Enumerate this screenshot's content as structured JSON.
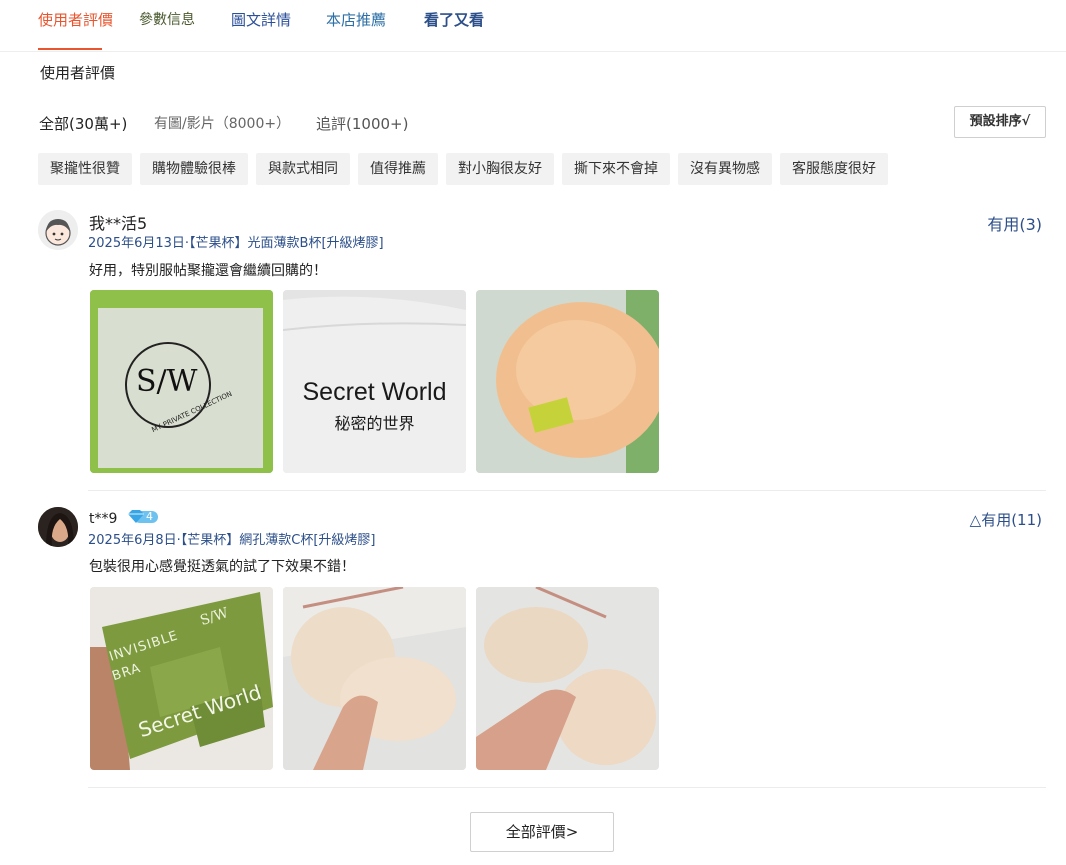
{
  "tabs": [
    {
      "label": "使用者評價",
      "color": "#e8552f"
    },
    {
      "label": "參數信息",
      "color": "#4b5a2e"
    },
    {
      "label": "圖文詳情",
      "color": "#2c4f9a"
    },
    {
      "label": "本店推薦",
      "color": "#2d6fa6"
    },
    {
      "label": "看了又看",
      "color": "#2c4f8a"
    }
  ],
  "section_title": "使用者評價",
  "filters": {
    "all": "全部(30萬+)",
    "media": "有圖/影片（8000+）",
    "followup": "追評(1000+)"
  },
  "sort_label": "預設排序√",
  "tags": [
    "聚攏性很贊",
    "購物體驗很棒",
    "與款式相同",
    "值得推薦",
    "對小胸很友好",
    "撕下來不會掉",
    "沒有異物感",
    "客服態度很好"
  ],
  "reviews": [
    {
      "username": "我**活5",
      "meta": "2025年6月13日·【芒果杯】光面薄款B杯[升級烤膠]",
      "comment": "好用，特別服帖聚攏還會繼續回購的！",
      "helpful": "有用(3)",
      "photos": [
        {
          "logo": "S/W",
          "caption": "MY PRIVATE COLLECTION"
        },
        {
          "brand": "Secret World",
          "subtitle": "秘密的世界"
        },
        {
          "label": "pad-photo"
        }
      ]
    },
    {
      "username": "t**9",
      "badge": "4",
      "meta": "2025年6月8日·【芒果杯】網孔薄款C杯[升級烤膠]",
      "comment": "包裝很用心感覺挺透氣的試了下效果不錯！",
      "helpful": "△有用(11)",
      "photos": [
        {
          "line1": "INVISIBLE",
          "line2": "BRA",
          "brand": "Secret World",
          "logo": "S/W"
        },
        {
          "label": "pad-photo"
        },
        {
          "label": "pad-photo"
        }
      ]
    }
  ],
  "all_reviews_button": "全部評價>"
}
